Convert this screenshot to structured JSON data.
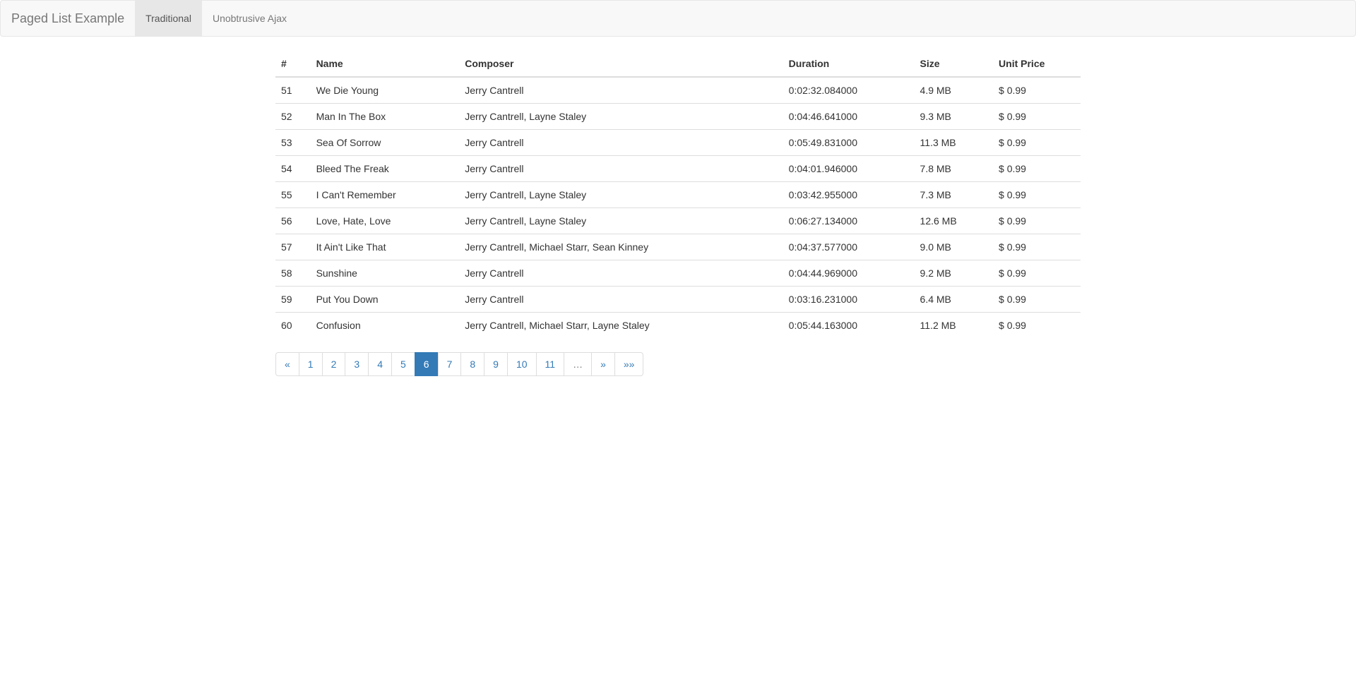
{
  "navbar": {
    "brand": "Paged List Example",
    "items": [
      {
        "label": "Traditional",
        "active": true
      },
      {
        "label": "Unobtrusive Ajax",
        "active": false
      }
    ]
  },
  "table": {
    "headers": {
      "id": "#",
      "name": "Name",
      "composer": "Composer",
      "duration": "Duration",
      "size": "Size",
      "price": "Unit Price"
    },
    "rows": [
      {
        "id": "51",
        "name": "We Die Young",
        "composer": "Jerry Cantrell",
        "duration": "0:02:32.084000",
        "size": "4.9 MB",
        "price": "$ 0.99"
      },
      {
        "id": "52",
        "name": "Man In The Box",
        "composer": "Jerry Cantrell, Layne Staley",
        "duration": "0:04:46.641000",
        "size": "9.3 MB",
        "price": "$ 0.99"
      },
      {
        "id": "53",
        "name": "Sea Of Sorrow",
        "composer": "Jerry Cantrell",
        "duration": "0:05:49.831000",
        "size": "11.3 MB",
        "price": "$ 0.99"
      },
      {
        "id": "54",
        "name": "Bleed The Freak",
        "composer": "Jerry Cantrell",
        "duration": "0:04:01.946000",
        "size": "7.8 MB",
        "price": "$ 0.99"
      },
      {
        "id": "55",
        "name": "I Can't Remember",
        "composer": "Jerry Cantrell, Layne Staley",
        "duration": "0:03:42.955000",
        "size": "7.3 MB",
        "price": "$ 0.99"
      },
      {
        "id": "56",
        "name": "Love, Hate, Love",
        "composer": "Jerry Cantrell, Layne Staley",
        "duration": "0:06:27.134000",
        "size": "12.6 MB",
        "price": "$ 0.99"
      },
      {
        "id": "57",
        "name": "It Ain't Like That",
        "composer": "Jerry Cantrell, Michael Starr, Sean Kinney",
        "duration": "0:04:37.577000",
        "size": "9.0 MB",
        "price": "$ 0.99"
      },
      {
        "id": "58",
        "name": "Sunshine",
        "composer": "Jerry Cantrell",
        "duration": "0:04:44.969000",
        "size": "9.2 MB",
        "price": "$ 0.99"
      },
      {
        "id": "59",
        "name": "Put You Down",
        "composer": "Jerry Cantrell",
        "duration": "0:03:16.231000",
        "size": "6.4 MB",
        "price": "$ 0.99"
      },
      {
        "id": "60",
        "name": "Confusion",
        "composer": "Jerry Cantrell, Michael Starr, Layne Staley",
        "duration": "0:05:44.163000",
        "size": "11.2 MB",
        "price": "$ 0.99"
      }
    ]
  },
  "pagination": {
    "items": [
      {
        "label": "«",
        "type": "link",
        "name": "first"
      },
      {
        "label": "1",
        "type": "link",
        "name": "page-1"
      },
      {
        "label": "2",
        "type": "link",
        "name": "page-2"
      },
      {
        "label": "3",
        "type": "link",
        "name": "page-3"
      },
      {
        "label": "4",
        "type": "link",
        "name": "page-4"
      },
      {
        "label": "5",
        "type": "link",
        "name": "page-5"
      },
      {
        "label": "6",
        "type": "active",
        "name": "page-6"
      },
      {
        "label": "7",
        "type": "link",
        "name": "page-7"
      },
      {
        "label": "8",
        "type": "link",
        "name": "page-8"
      },
      {
        "label": "9",
        "type": "link",
        "name": "page-9"
      },
      {
        "label": "10",
        "type": "link",
        "name": "page-10"
      },
      {
        "label": "11",
        "type": "link",
        "name": "page-11"
      },
      {
        "label": "…",
        "type": "disabled",
        "name": "ellipsis"
      },
      {
        "label": "»",
        "type": "link",
        "name": "next"
      },
      {
        "label": "»»",
        "type": "link",
        "name": "last"
      }
    ]
  }
}
